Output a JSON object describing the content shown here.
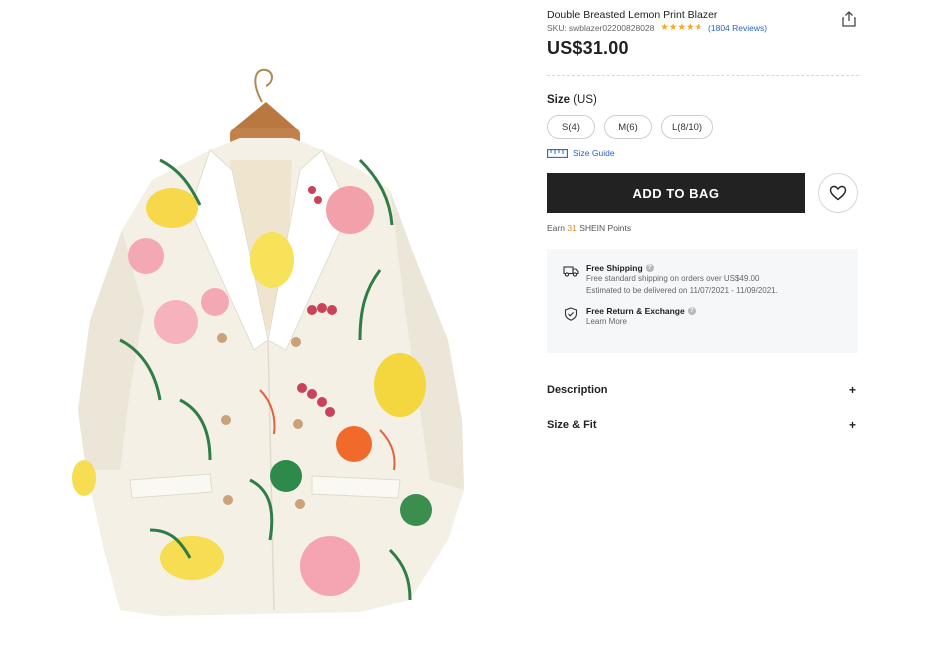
{
  "product": {
    "title": "Double Breasted Lemon Print Blazer",
    "sku_label": "SKU:",
    "sku": "swblazer02200828028",
    "rating": 4.5,
    "reviews_text": "(1804 Reviews)",
    "price": "US$31.00",
    "image_alt": "Double breasted white blazer with lemon, grapefruit and leaf print on a wooden hanger"
  },
  "size": {
    "heading": "Size",
    "unit": "(US)",
    "options": [
      "S(4)",
      "M(6)",
      "L(8/10)"
    ],
    "guide_label": "Size Guide"
  },
  "actions": {
    "add_to_bag": "ADD TO BAG"
  },
  "points": {
    "prefix": "Earn",
    "amount": "31",
    "suffix": "SHEIN Points"
  },
  "shipping": {
    "free_shipping_title": "Free Shipping",
    "free_shipping_line1": "Free standard shipping on orders over US$49.00",
    "free_shipping_line2": "Estimated to be delivered on 11/07/2021 - 11/09/2021.",
    "return_title": "Free Return & Exchange",
    "return_link": "Learn More"
  },
  "accordion": {
    "description": "Description",
    "size_fit": "Size & Fit",
    "expand_symbol": "+"
  },
  "colors": {
    "star": "#f5a623",
    "link": "#2962c6",
    "button": "#222222",
    "points": "#f08a1c",
    "info_box": "#f6f7f9"
  },
  "icons": {
    "share": "share-icon",
    "ruler": "ruler-icon",
    "heart": "heart-icon",
    "truck": "truck-icon",
    "shield": "shield-check-icon",
    "help": "question-icon"
  }
}
